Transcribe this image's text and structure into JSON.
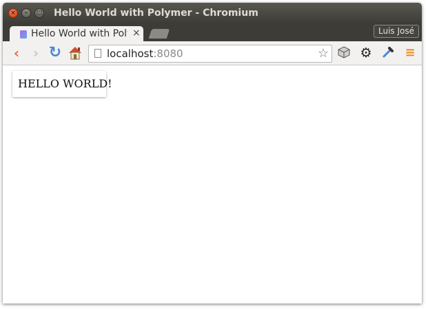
{
  "window": {
    "title": "Hello World with Polymer - Chromium",
    "controls": {
      "close": "×",
      "minimize": "–",
      "maximize": "□"
    }
  },
  "tabs": [
    {
      "label": "Hello World with Polymer",
      "favicon": "polymer-icon",
      "close": "×",
      "active": true
    }
  ],
  "profile": {
    "name": "Luis José"
  },
  "toolbar": {
    "back_icon": "‹",
    "forward_icon": "›",
    "reload_icon": "↻",
    "home_icon": "home-icon",
    "address": {
      "host": "localhost",
      "port": ":8080"
    },
    "bookmark_icon": "☆",
    "extensions": [
      "extension-cube-icon",
      "settings-gear-icon",
      "eyedropper-icon"
    ],
    "gear_icon": "⚙",
    "menu_icon": "≡"
  },
  "page": {
    "card_text": "HELLO WORLD!"
  },
  "colors": {
    "titlebar": "#3d3c37",
    "close_button": "#df4b1c",
    "back_arrow": "#e2703c",
    "reload": "#4a86d6",
    "menu": "#e78a1d"
  }
}
